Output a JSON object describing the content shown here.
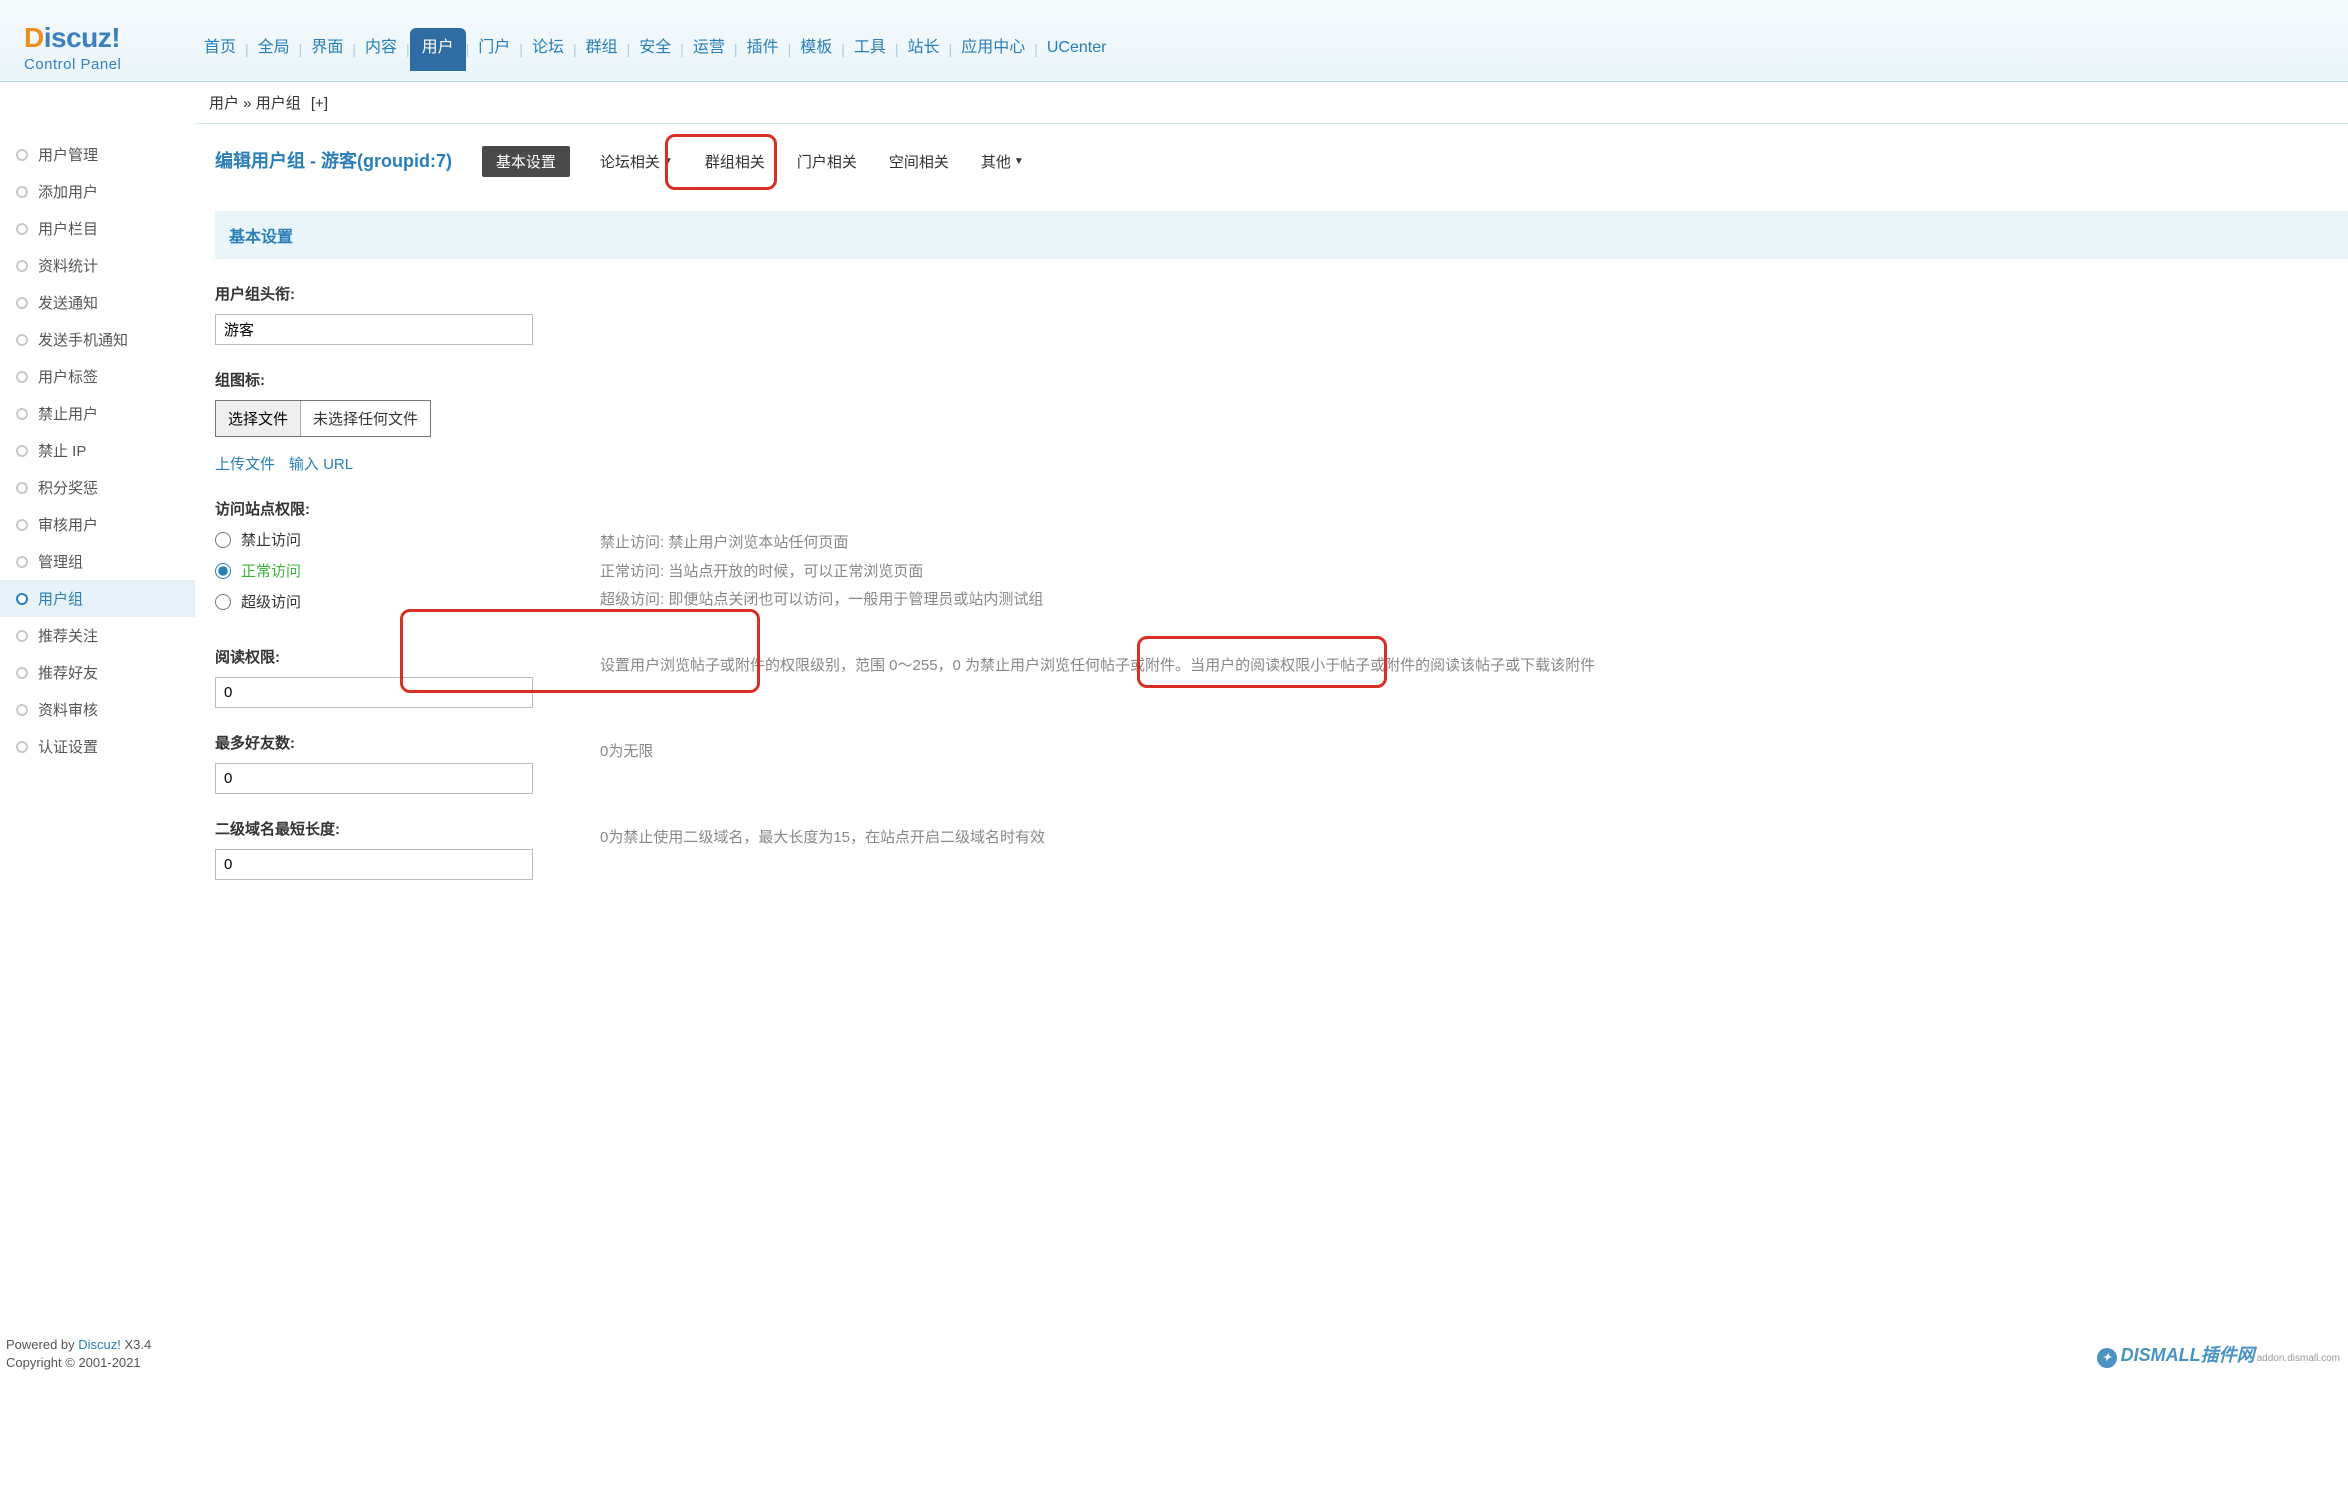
{
  "logo": {
    "d": "D",
    "rest": "iscuz!",
    "sub": "Control Panel"
  },
  "topnav": [
    "首页",
    "全局",
    "界面",
    "内容",
    "用户",
    "门户",
    "论坛",
    "群组",
    "安全",
    "运营",
    "插件",
    "模板",
    "工具",
    "站长",
    "应用中心",
    "UCenter"
  ],
  "topnav_active": 4,
  "breadcrumb": {
    "a": "用户",
    "sep": " » ",
    "b": "用户组",
    "add": "[+]"
  },
  "sidebar": [
    "用户管理",
    "添加用户",
    "用户栏目",
    "资料统计",
    "发送通知",
    "发送手机通知",
    "用户标签",
    "禁止用户",
    "禁止 IP",
    "积分奖惩",
    "审核用户",
    "管理组",
    "用户组",
    "推荐关注",
    "推荐好友",
    "资料审核",
    "认证设置"
  ],
  "sidebar_active": 12,
  "page_title": "编辑用户组 - 游客(groupid:7)",
  "subtabs": {
    "basic": "基本设置",
    "forum": "论坛相关",
    "group": "群组相关",
    "portal": "门户相关",
    "space": "空间相关",
    "other": "其他"
  },
  "section_header": "基本设置",
  "fields": {
    "title_label": "用户组头衔:",
    "title_value": "游客",
    "icon_label": "组图标:",
    "choose_file": "选择文件",
    "no_file": "未选择任何文件",
    "upload_link": "上传文件",
    "url_link": "输入 URL",
    "access_label": "访问站点权限:",
    "access_opts": {
      "deny": "禁止访问",
      "normal": "正常访问",
      "super": "超级访问"
    },
    "access_notes": {
      "deny": "禁止访问: 禁止用户浏览本站任何页面",
      "normal": "正常访问: 当站点开放的时候，可以正常浏览页面",
      "super": "超级访问: 即便站点关闭也可以访问，一般用于管理员或站内测试组"
    },
    "read_label": "阅读权限:",
    "read_value": "0",
    "read_desc_a": "设置用户浏览帖子或附件的权限级别，范围 0～255，",
    "read_desc_b": "0 为禁止用户浏览任何帖子或附件。",
    "read_desc_c": "当用户的阅读权限小于帖子或附件的阅读该帖子或下载该附件",
    "friends_label": "最多好友数:",
    "friends_value": "0",
    "friends_desc": "0为无限",
    "domain_label": "二级域名最短长度:",
    "domain_value": "0",
    "domain_desc": "0为禁止使用二级域名，最大长度为15，在站点开启二级域名时有效"
  },
  "footer": {
    "l1a": "Powered by ",
    "l1b": "Discuz!",
    "l1c": " X3.4",
    "l2": "Copyright © 2001-2021"
  },
  "watermark": {
    "main": "DISMALL插件网",
    "sub": "addon.dismall.com"
  }
}
